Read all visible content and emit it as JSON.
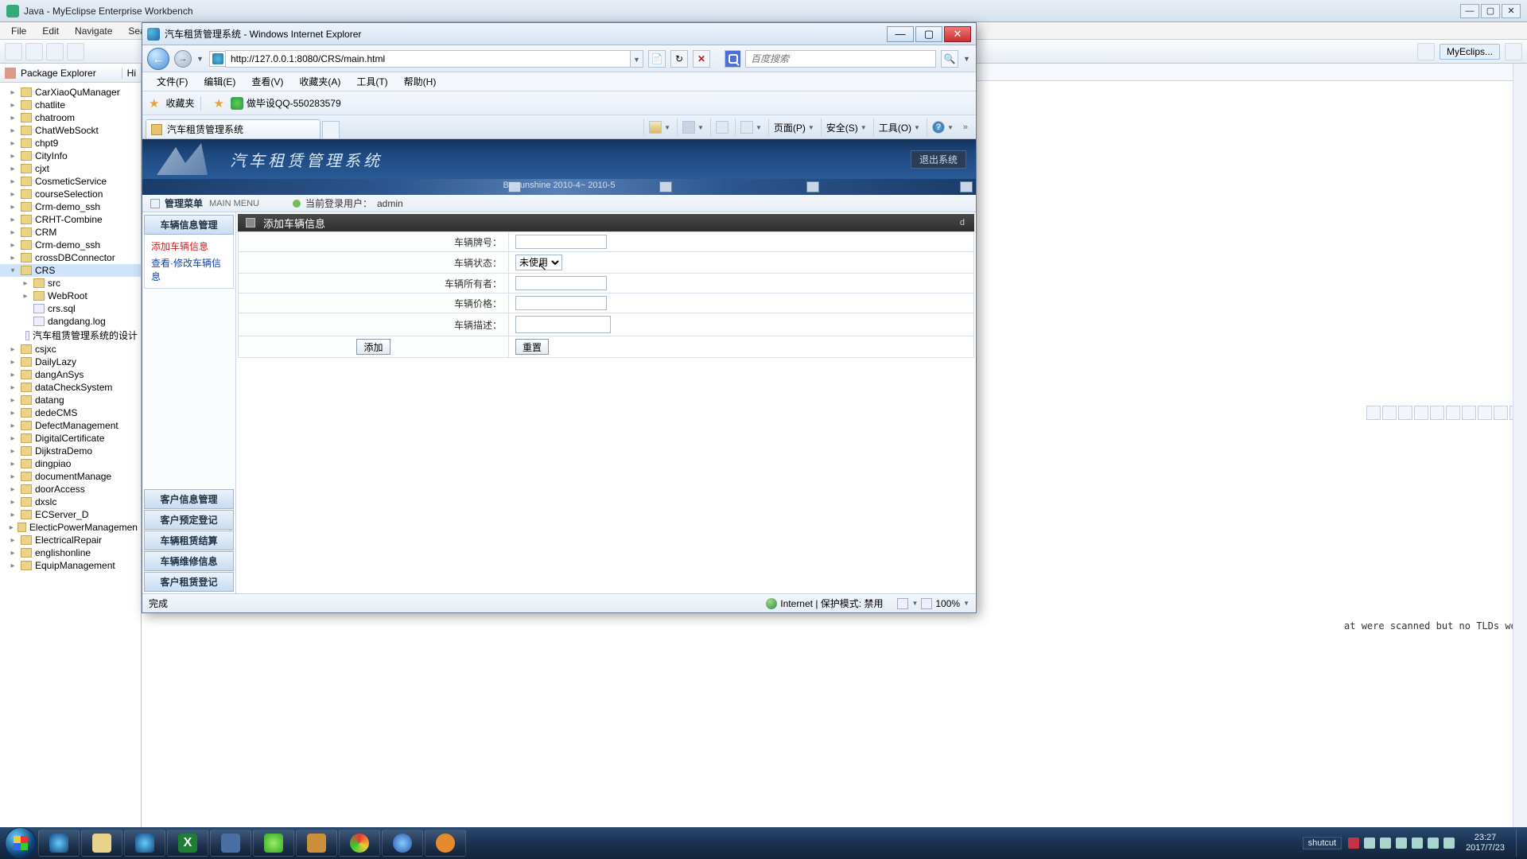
{
  "eclipse": {
    "title": "Java - MyEclipse Enterprise Workbench",
    "menu": [
      "File",
      "Edit",
      "Navigate",
      "Search"
    ],
    "perspective": "MyEclips...",
    "pkg_explorer": "Package Explorer",
    "pkg_tab2": "Hi",
    "projects": [
      "CarXiaoQuManager",
      "chatlite",
      "chatroom",
      "ChatWebSockt",
      "chpt9",
      "CityInfo",
      "cjxt",
      "CosmeticService",
      "courseSelection",
      "Crm-demo_ssh",
      "CRHT-Combine",
      "CRM",
      "Crm-demo_ssh",
      "crossDBConnector"
    ],
    "crs": {
      "name": "CRS",
      "children": [
        "src",
        "WebRoot",
        "crs.sql",
        "dangdang.log",
        "汽车租赁管理系统的设计"
      ]
    },
    "projects2": [
      "csjxc",
      "DailyLazy",
      "dangAnSys",
      "dataCheckSystem",
      "datang",
      "dedeCMS",
      "DefectManagement",
      "DigitalCertificate",
      "DijkstraDemo",
      "dingpiao",
      "documentManage",
      "doorAccess",
      "dxslc",
      "ECServer_D",
      "ElecticPowerManagemen",
      "ElectricalRepair",
      "englishonline",
      "EquipManagement"
    ],
    "console_snip": "at were scanned but no TLDs wer"
  },
  "ie": {
    "title": "汽车租赁管理系统 - Windows Internet Explorer",
    "url": "http://127.0.0.1:8080/CRS/main.html",
    "search_placeholder": "百度搜索",
    "menu": [
      "文件(F)",
      "编辑(E)",
      "查看(V)",
      "收藏夹(A)",
      "工具(T)",
      "帮助(H)"
    ],
    "fav_label": "收藏夹",
    "fav_link": "做毕设QQ-550283579",
    "tab": "汽车租赁管理系统",
    "cmd": {
      "page": "页面(P)",
      "safety": "安全(S)",
      "tools": "工具(O)"
    },
    "status_done": "完成",
    "status_zone": "Internet | 保护模式: 禁用",
    "zoom": "100%"
  },
  "app": {
    "banner_title": "汽车租赁管理系统",
    "exit": "退出系统",
    "subbar": "By sunshine 2010-4~ 2010-5",
    "info_menu": "管理菜单",
    "info_menu_sub": "MAIN MENU",
    "info_user_lbl": "当前登录用户：",
    "info_user": "admin",
    "side": {
      "sec1": "车辆信息管理",
      "items1": [
        "添加车辆信息",
        "查看·修改车辆信息"
      ],
      "others": [
        "客户信息管理",
        "客户预定登记",
        "车辆租赁结算",
        "车辆维修信息",
        "客户租赁登记"
      ]
    },
    "form": {
      "title": "添加车辆信息",
      "rch": "d",
      "lbl_plate": "车辆牌号：",
      "lbl_status": "车辆状态：",
      "lbl_owner": "车辆所有者：",
      "lbl_price": "车辆价格：",
      "lbl_desc": "车辆描述：",
      "status_opt": "未使用",
      "btn_add": "添加",
      "btn_reset": "重置"
    }
  },
  "taskbar": {
    "lang": "shutcut",
    "time": "23:27",
    "date": "2017/7/23"
  }
}
